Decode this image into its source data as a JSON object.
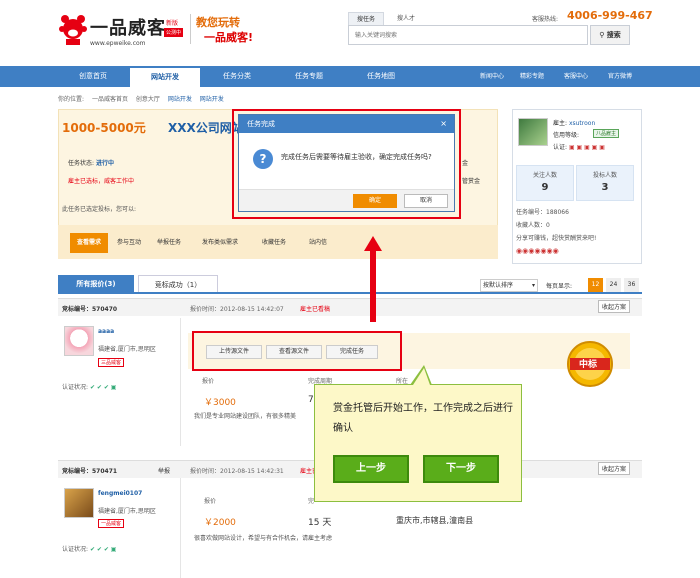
{
  "header": {
    "brand": "一品威客",
    "brand_new": "新版",
    "brand_beta": "公测中",
    "url": "www.epweike.com",
    "slogan1": "教您玩转",
    "slogan2": "一品威客!",
    "search_tabs": [
      "搜任务",
      "搜人才"
    ],
    "search_placeholder": "输入关键词搜索",
    "search_button": "搜索",
    "hotline_label": "客服热线:",
    "hotline": "4006-999-467"
  },
  "nav": {
    "items": [
      "创意首页",
      "网站开发",
      "任务分类",
      "任务专题",
      "任务地图"
    ],
    "right": [
      "新闻中心",
      "精彩专题",
      "客服中心",
      "官方微博"
    ]
  },
  "breadcrumb": [
    "你的位置:",
    "一品威客首页",
    "创意大厅",
    "网站开发",
    "网站开发"
  ],
  "task": {
    "price": "1000-5000元",
    "name": "XXX公司网站",
    "status_label": "任务状态:",
    "status_value": "进行中",
    "warning": "雇主已选标，威客工作中",
    "sub": "此任务已选定投标，您可以:",
    "right_frag1": "金",
    "right_frag2": "管赏金",
    "tabs": [
      "查看需求",
      "参与互动",
      "举报任务",
      "发布类似需求",
      "收藏任务",
      "站内信"
    ]
  },
  "profile": {
    "owner_label": "雇主:",
    "owner_name": "xsutroon",
    "credit_label": "信用等级:",
    "credit_badge": "八品雇主",
    "verify_label": "认证:",
    "following_label": "关注人数",
    "following_value": "9",
    "bids_label": "投标人数",
    "bids_value": "3",
    "task_no": "任务编号：188066",
    "favorites": "收藏人数：0",
    "share": "分享可赚钱，超快赏酬赏来吧!"
  },
  "bids": {
    "tabs": [
      "所有报价(3)",
      "竞标成功（1）"
    ],
    "sort": "按默认排序",
    "per_page_label": "每页显示:",
    "pages": [
      "12",
      "24",
      "36"
    ],
    "rows": [
      {
        "no": "竞标编号：570470",
        "time": "报价时间：2012-08-15 14:42:07",
        "flag": "雇主已看稿",
        "collapse": "收起方案",
        "user": "aaaa",
        "addr": "福建省,厦门市,思明区",
        "level": "三品威客",
        "verify": "认证状况:",
        "buttons": [
          "上传源文件",
          "查看源文件",
          "完成任务"
        ],
        "col_price": "报价",
        "col_period": "完成周期",
        "col_loc": "所在",
        "price": "￥3000",
        "period": "7",
        "desc": "我们是专业网站建设团队，有很多精美",
        "medal": "中标"
      },
      {
        "no": "竞标编号：570471",
        "report": "举报",
        "time": "报价时间：2012-08-15 14:42:31",
        "flag": "雇主已看稿",
        "collapse": "收起方案",
        "user": "fengmei0107",
        "addr": "福建省,厦门市,思明区",
        "level": "一品威客",
        "verify": "认证状况:",
        "col_price": "报价",
        "col_period": "完",
        "price": "￥2000",
        "period": "15 天",
        "loc": "重庆市,市辖县,潼南县",
        "desc": "很喜欢做网站设计，希望与有合作机会，请雇主考虑"
      }
    ]
  },
  "modal": {
    "title": "任务完成",
    "close": "×",
    "message": "完成任务后需要等待雇主验收，确定完成任务吗?",
    "ok": "确定",
    "cancel": "取消"
  },
  "tour": {
    "text": "赏金托管后开始工作，工作完成之后进行确认",
    "prev": "上一步",
    "next": "下一步"
  }
}
